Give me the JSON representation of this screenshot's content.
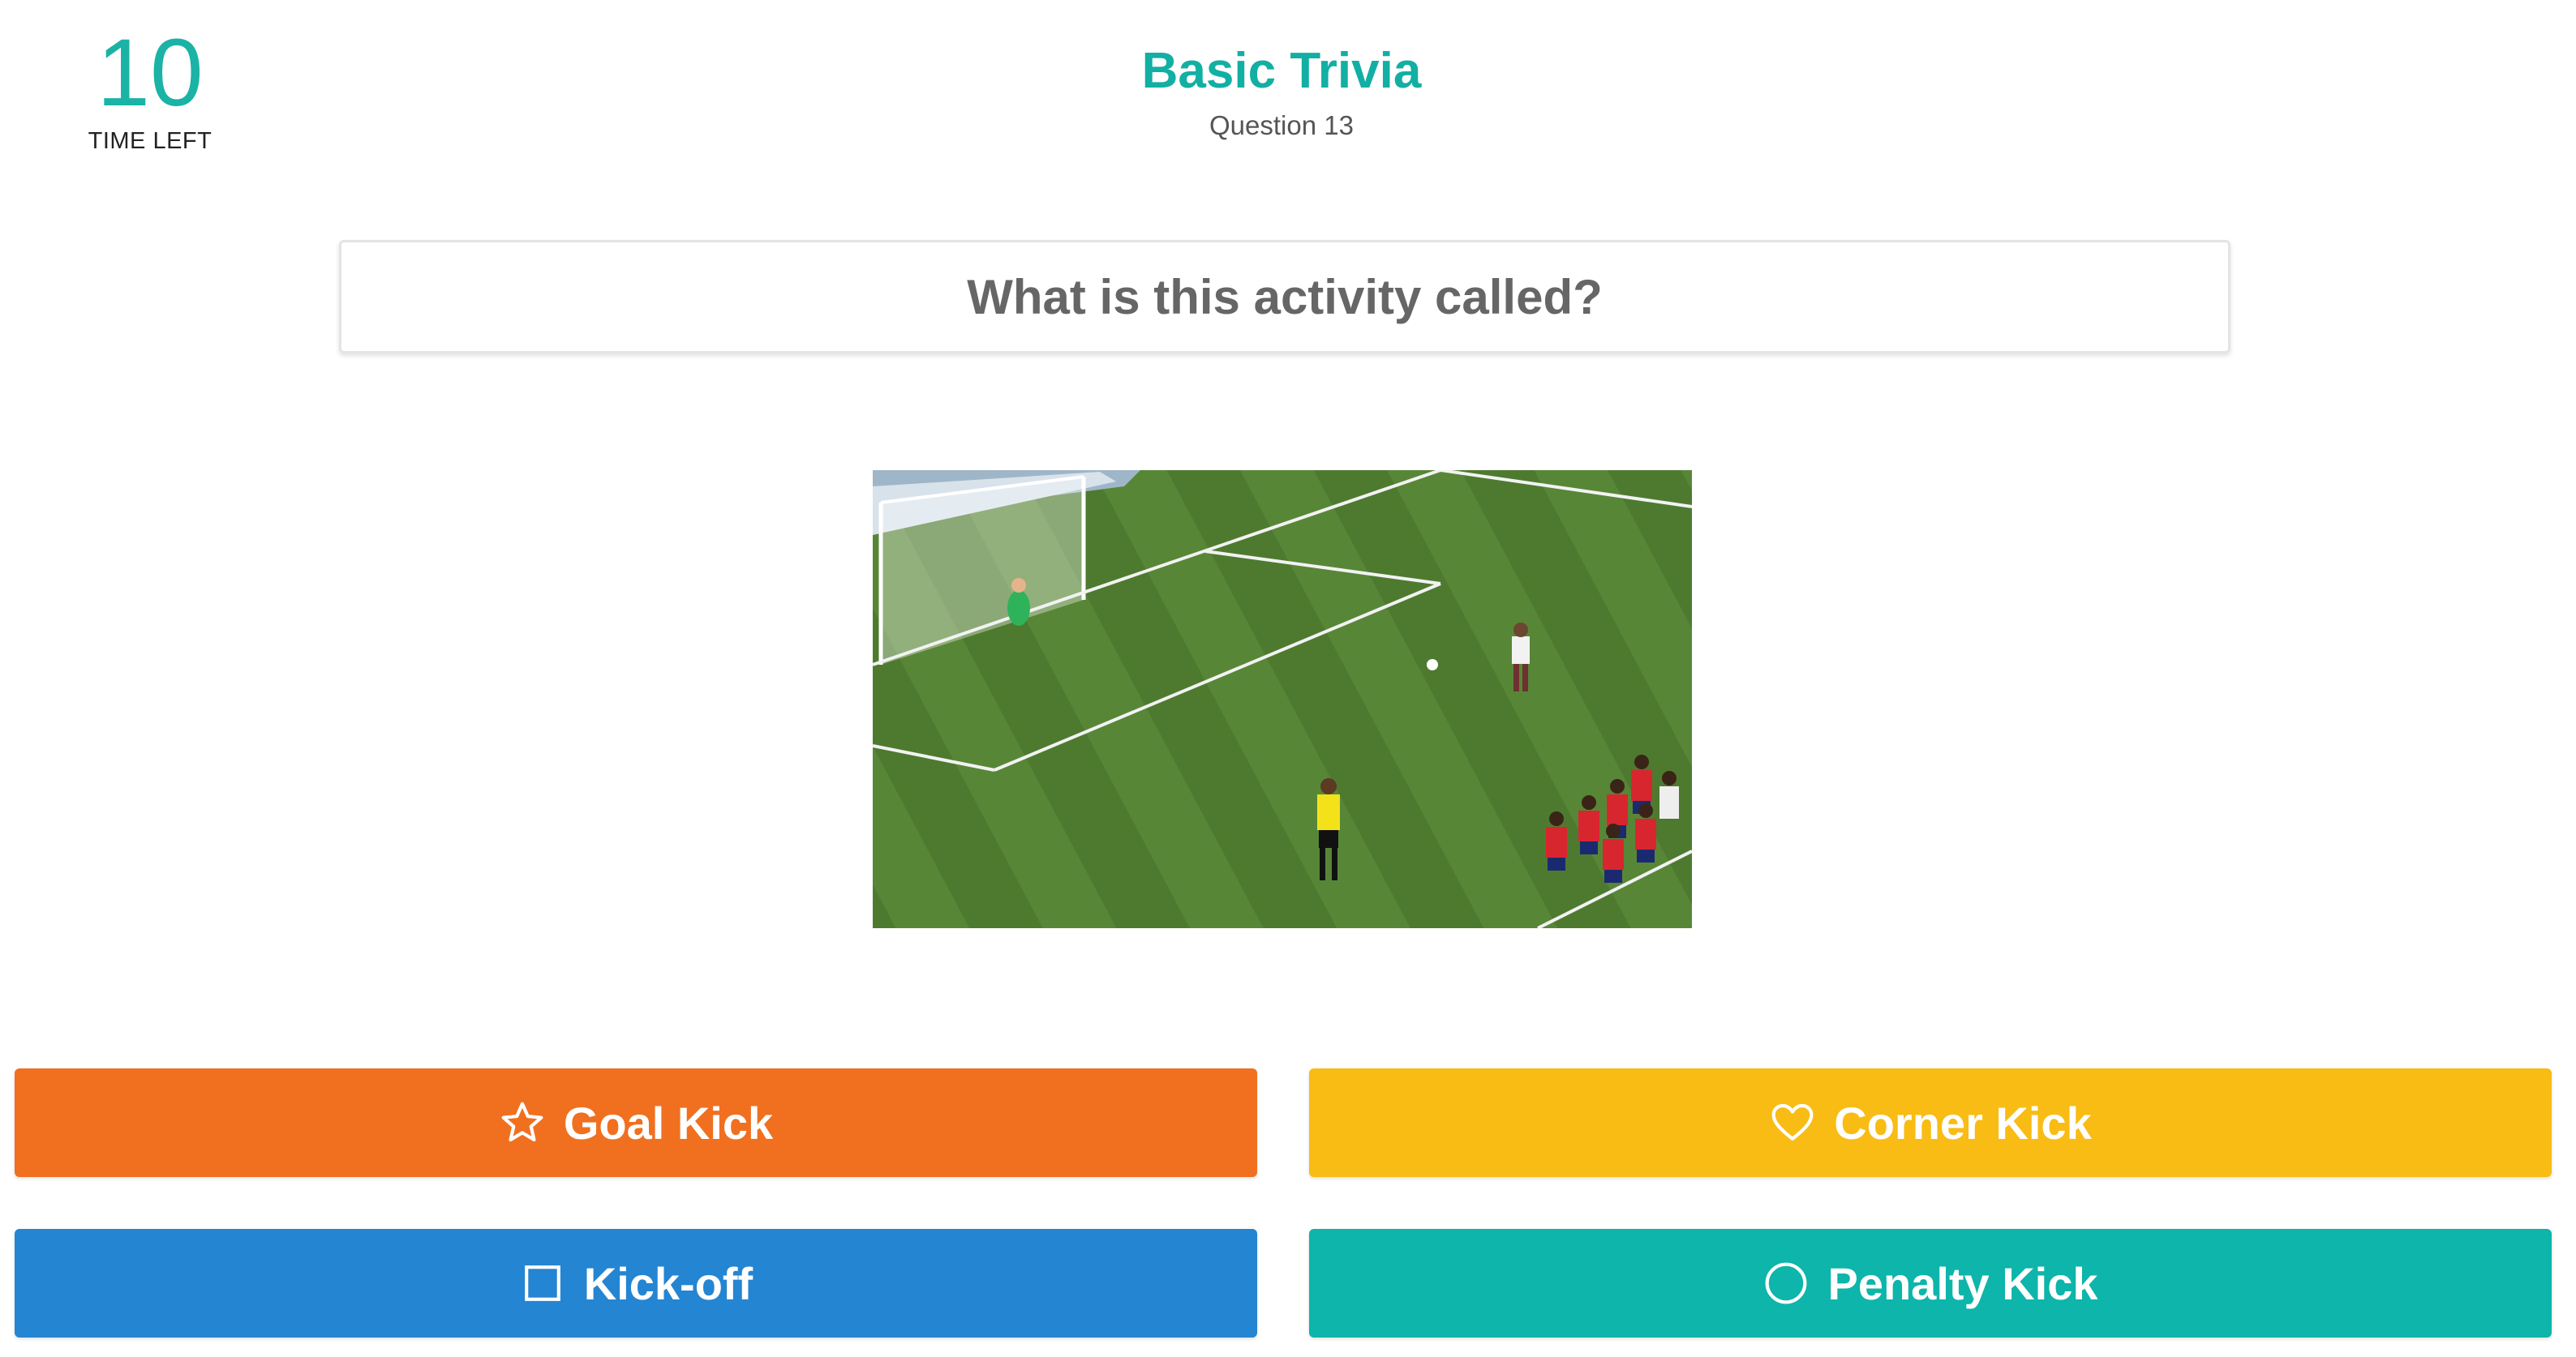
{
  "timer": {
    "value": "10",
    "label": "TIME LEFT"
  },
  "quiz": {
    "title": "Basic Trivia",
    "question_number": "Question 13"
  },
  "question": {
    "text": "What is this activity called?"
  },
  "picture": {
    "subject": "soccer penalty kick photo"
  },
  "answers": [
    {
      "label": "Goal Kick",
      "icon": "star-icon",
      "color": "#f07020"
    },
    {
      "label": "Corner Kick",
      "icon": "heart-icon",
      "color": "#f9bc14"
    },
    {
      "label": "Kick-off",
      "icon": "square-icon",
      "color": "#2485d2"
    },
    {
      "label": "Penalty Kick",
      "icon": "circle-icon",
      "color": "#0db5aa"
    }
  ],
  "colors": {
    "accent": "#1ab3a6",
    "question_text": "#666666"
  }
}
